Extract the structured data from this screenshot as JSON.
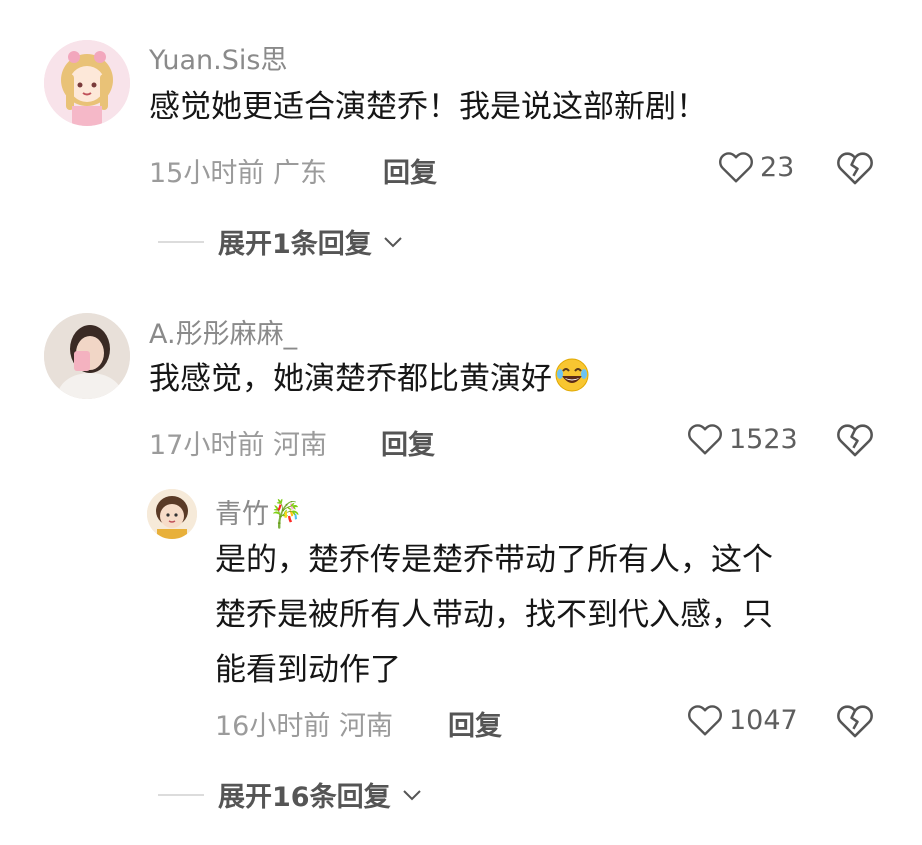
{
  "comments": [
    {
      "username": "Yuan.Sis思",
      "content": "感觉她更适合演楚乔！我是说这部新剧！",
      "time": "15小时前",
      "location": "广东",
      "reply_label": "回复",
      "likes": "23",
      "expand_label": "展开1条回复"
    },
    {
      "username": "A.彤彤麻麻_",
      "content": "我感觉，她演楚乔都比黄演好",
      "emoji": "tears-of-joy-emoji",
      "time": "17小时前",
      "location": "河南",
      "reply_label": "回复",
      "likes": "1523",
      "reply": {
        "username": "青竹🎋",
        "content_lines": [
          "是的，楚乔传是楚乔带动了所有人，这个",
          "楚乔是被所有人带动，找不到代入感，只",
          "能看到动作了"
        ],
        "time": "16小时前",
        "location": "河南",
        "reply_label": "回复",
        "likes": "1047"
      },
      "expand_label": "展开16条回复"
    }
  ],
  "colors": {
    "text": "#161616",
    "meta": "#9b9b9b",
    "username": "#8a8a8a",
    "action": "#555555"
  },
  "icons": [
    "heart-outline-icon",
    "broken-heart-icon",
    "chevron-down-icon"
  ]
}
